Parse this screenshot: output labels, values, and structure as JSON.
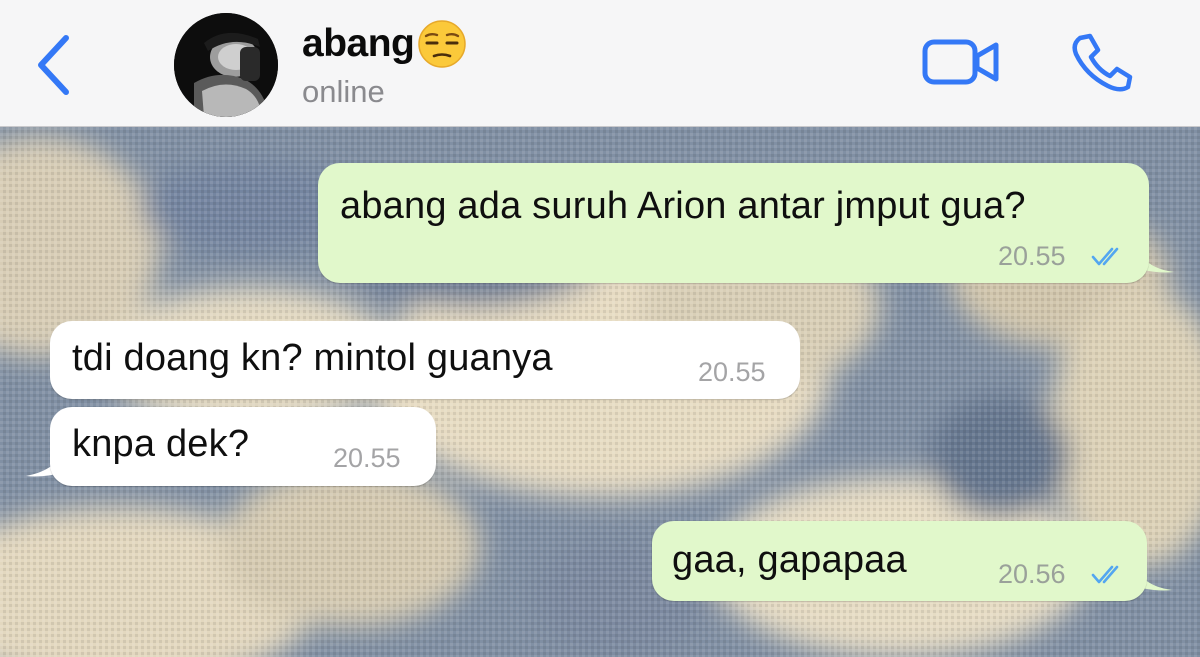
{
  "header": {
    "contact_name": "abang",
    "status": "online",
    "emoji": "unamused-face-emoji",
    "back_icon": "chevron-left-icon",
    "video_icon": "video-camera-icon",
    "call_icon": "phone-icon",
    "accent_color": "#3478f6"
  },
  "messages": [
    {
      "direction": "outgoing",
      "text": "abang ada suruh Arion antar jmput gua?",
      "time": "20.55",
      "read": true
    },
    {
      "direction": "incoming",
      "text": "tdi doang kn? mintol guanya",
      "time": "20.55"
    },
    {
      "direction": "incoming",
      "text": "knpa dek?",
      "time": "20.55"
    },
    {
      "direction": "outgoing",
      "text": "gaa, gapapaa",
      "time": "20.56",
      "read": true
    }
  ],
  "colors": {
    "outgoing_bubble": "#e1f8cb",
    "incoming_bubble": "#ffffff",
    "read_ticks": "#53a6f0"
  }
}
